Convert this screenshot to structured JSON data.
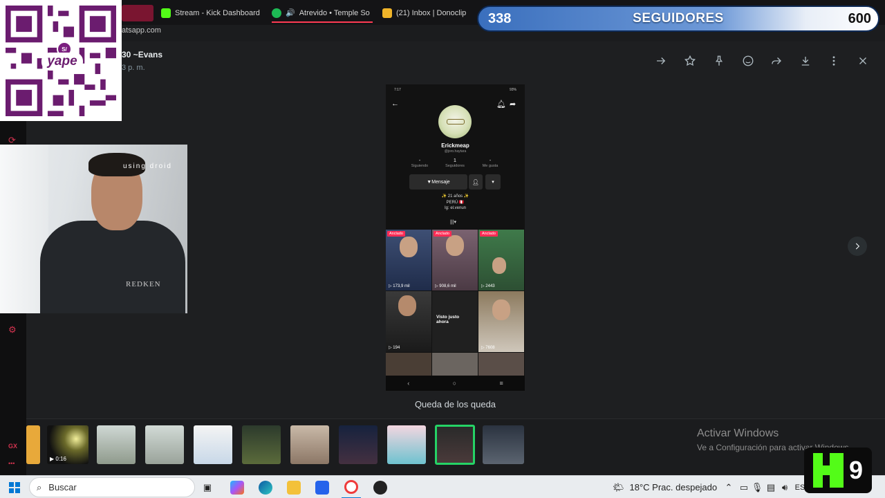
{
  "browser": {
    "tabs": [
      {
        "label": "Stream - Kick Dashboard"
      },
      {
        "label": "Atrevido • Temple So"
      },
      {
        "label": "(21) Inbox | Donoclip"
      }
    ],
    "address": "atsapp.com"
  },
  "followers": {
    "current": "338",
    "label": "SEGUIDORES",
    "goal": "600"
  },
  "viewer": {
    "contact_name": "30 ~Evans",
    "time": "3 p. m.",
    "caption": "Queda de los queda"
  },
  "phone": {
    "status_time": "7:17",
    "battery": "93%",
    "name": "Erickmeap",
    "handle": "@joro.haytara",
    "stats": [
      {
        "value": "-",
        "label": "Siguiendo"
      },
      {
        "value": "1",
        "label": "Seguidores"
      },
      {
        "value": "-",
        "label": "Me gusta"
      }
    ],
    "message_button": "Mensaje",
    "bio": [
      "✨ 21 años ✨",
      "PERÚ 🇵🇪",
      "Ig: el.venun"
    ],
    "videos": [
      {
        "badge": "Anclado",
        "count": "173,9 mil"
      },
      {
        "badge": "Anclado",
        "count": "908,6 mil"
      },
      {
        "badge": "Anclado",
        "count": "2443"
      },
      {
        "badge": "",
        "count": "194"
      },
      {
        "badge": "",
        "count": "",
        "overlay": "Visto justo ahora"
      },
      {
        "badge": "",
        "count": "7608"
      }
    ]
  },
  "filmstrip": {
    "video_duration": "0:16"
  },
  "watermark": {
    "title": "Activar Windows",
    "subtitle": "Ve a Configuración para activar Windows."
  },
  "webcam": {
    "overlay_text": "using droid",
    "shirt_brand": "REDKEN"
  },
  "qr": {
    "brand": "yape",
    "badge": "S/"
  },
  "kick_badge": {
    "number": "9"
  },
  "taskbar": {
    "search_placeholder": "Buscar",
    "weather": "18°C  Prac. despejado",
    "lang": "ES"
  },
  "colors": {
    "accent": "#25d366",
    "kick": "#53fc18",
    "yape": "#7b1f7f",
    "follower_bar": "#3a6fbd"
  }
}
